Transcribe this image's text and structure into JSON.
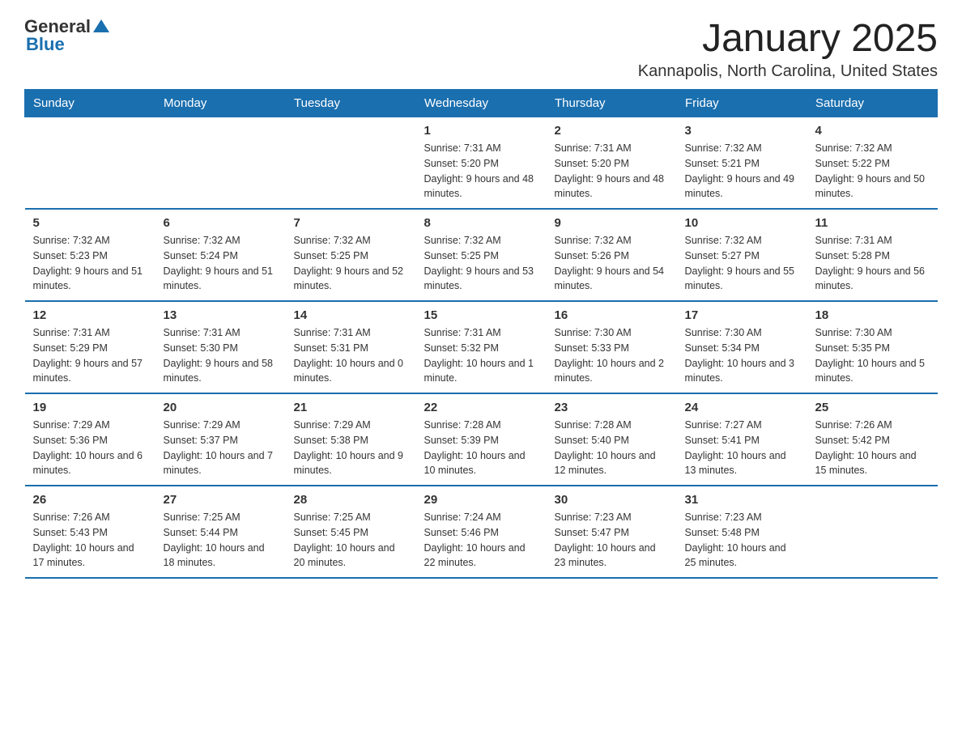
{
  "logo": {
    "general": "General",
    "blue": "Blue"
  },
  "title": "January 2025",
  "location": "Kannapolis, North Carolina, United States",
  "days_of_week": [
    "Sunday",
    "Monday",
    "Tuesday",
    "Wednesday",
    "Thursday",
    "Friday",
    "Saturday"
  ],
  "weeks": [
    [
      {
        "day": "",
        "info": ""
      },
      {
        "day": "",
        "info": ""
      },
      {
        "day": "",
        "info": ""
      },
      {
        "day": "1",
        "info": "Sunrise: 7:31 AM\nSunset: 5:20 PM\nDaylight: 9 hours and 48 minutes."
      },
      {
        "day": "2",
        "info": "Sunrise: 7:31 AM\nSunset: 5:20 PM\nDaylight: 9 hours and 48 minutes."
      },
      {
        "day": "3",
        "info": "Sunrise: 7:32 AM\nSunset: 5:21 PM\nDaylight: 9 hours and 49 minutes."
      },
      {
        "day": "4",
        "info": "Sunrise: 7:32 AM\nSunset: 5:22 PM\nDaylight: 9 hours and 50 minutes."
      }
    ],
    [
      {
        "day": "5",
        "info": "Sunrise: 7:32 AM\nSunset: 5:23 PM\nDaylight: 9 hours and 51 minutes."
      },
      {
        "day": "6",
        "info": "Sunrise: 7:32 AM\nSunset: 5:24 PM\nDaylight: 9 hours and 51 minutes."
      },
      {
        "day": "7",
        "info": "Sunrise: 7:32 AM\nSunset: 5:25 PM\nDaylight: 9 hours and 52 minutes."
      },
      {
        "day": "8",
        "info": "Sunrise: 7:32 AM\nSunset: 5:25 PM\nDaylight: 9 hours and 53 minutes."
      },
      {
        "day": "9",
        "info": "Sunrise: 7:32 AM\nSunset: 5:26 PM\nDaylight: 9 hours and 54 minutes."
      },
      {
        "day": "10",
        "info": "Sunrise: 7:32 AM\nSunset: 5:27 PM\nDaylight: 9 hours and 55 minutes."
      },
      {
        "day": "11",
        "info": "Sunrise: 7:31 AM\nSunset: 5:28 PM\nDaylight: 9 hours and 56 minutes."
      }
    ],
    [
      {
        "day": "12",
        "info": "Sunrise: 7:31 AM\nSunset: 5:29 PM\nDaylight: 9 hours and 57 minutes."
      },
      {
        "day": "13",
        "info": "Sunrise: 7:31 AM\nSunset: 5:30 PM\nDaylight: 9 hours and 58 minutes."
      },
      {
        "day": "14",
        "info": "Sunrise: 7:31 AM\nSunset: 5:31 PM\nDaylight: 10 hours and 0 minutes."
      },
      {
        "day": "15",
        "info": "Sunrise: 7:31 AM\nSunset: 5:32 PM\nDaylight: 10 hours and 1 minute."
      },
      {
        "day": "16",
        "info": "Sunrise: 7:30 AM\nSunset: 5:33 PM\nDaylight: 10 hours and 2 minutes."
      },
      {
        "day": "17",
        "info": "Sunrise: 7:30 AM\nSunset: 5:34 PM\nDaylight: 10 hours and 3 minutes."
      },
      {
        "day": "18",
        "info": "Sunrise: 7:30 AM\nSunset: 5:35 PM\nDaylight: 10 hours and 5 minutes."
      }
    ],
    [
      {
        "day": "19",
        "info": "Sunrise: 7:29 AM\nSunset: 5:36 PM\nDaylight: 10 hours and 6 minutes."
      },
      {
        "day": "20",
        "info": "Sunrise: 7:29 AM\nSunset: 5:37 PM\nDaylight: 10 hours and 7 minutes."
      },
      {
        "day": "21",
        "info": "Sunrise: 7:29 AM\nSunset: 5:38 PM\nDaylight: 10 hours and 9 minutes."
      },
      {
        "day": "22",
        "info": "Sunrise: 7:28 AM\nSunset: 5:39 PM\nDaylight: 10 hours and 10 minutes."
      },
      {
        "day": "23",
        "info": "Sunrise: 7:28 AM\nSunset: 5:40 PM\nDaylight: 10 hours and 12 minutes."
      },
      {
        "day": "24",
        "info": "Sunrise: 7:27 AM\nSunset: 5:41 PM\nDaylight: 10 hours and 13 minutes."
      },
      {
        "day": "25",
        "info": "Sunrise: 7:26 AM\nSunset: 5:42 PM\nDaylight: 10 hours and 15 minutes."
      }
    ],
    [
      {
        "day": "26",
        "info": "Sunrise: 7:26 AM\nSunset: 5:43 PM\nDaylight: 10 hours and 17 minutes."
      },
      {
        "day": "27",
        "info": "Sunrise: 7:25 AM\nSunset: 5:44 PM\nDaylight: 10 hours and 18 minutes."
      },
      {
        "day": "28",
        "info": "Sunrise: 7:25 AM\nSunset: 5:45 PM\nDaylight: 10 hours and 20 minutes."
      },
      {
        "day": "29",
        "info": "Sunrise: 7:24 AM\nSunset: 5:46 PM\nDaylight: 10 hours and 22 minutes."
      },
      {
        "day": "30",
        "info": "Sunrise: 7:23 AM\nSunset: 5:47 PM\nDaylight: 10 hours and 23 minutes."
      },
      {
        "day": "31",
        "info": "Sunrise: 7:23 AM\nSunset: 5:48 PM\nDaylight: 10 hours and 25 minutes."
      },
      {
        "day": "",
        "info": ""
      }
    ]
  ]
}
